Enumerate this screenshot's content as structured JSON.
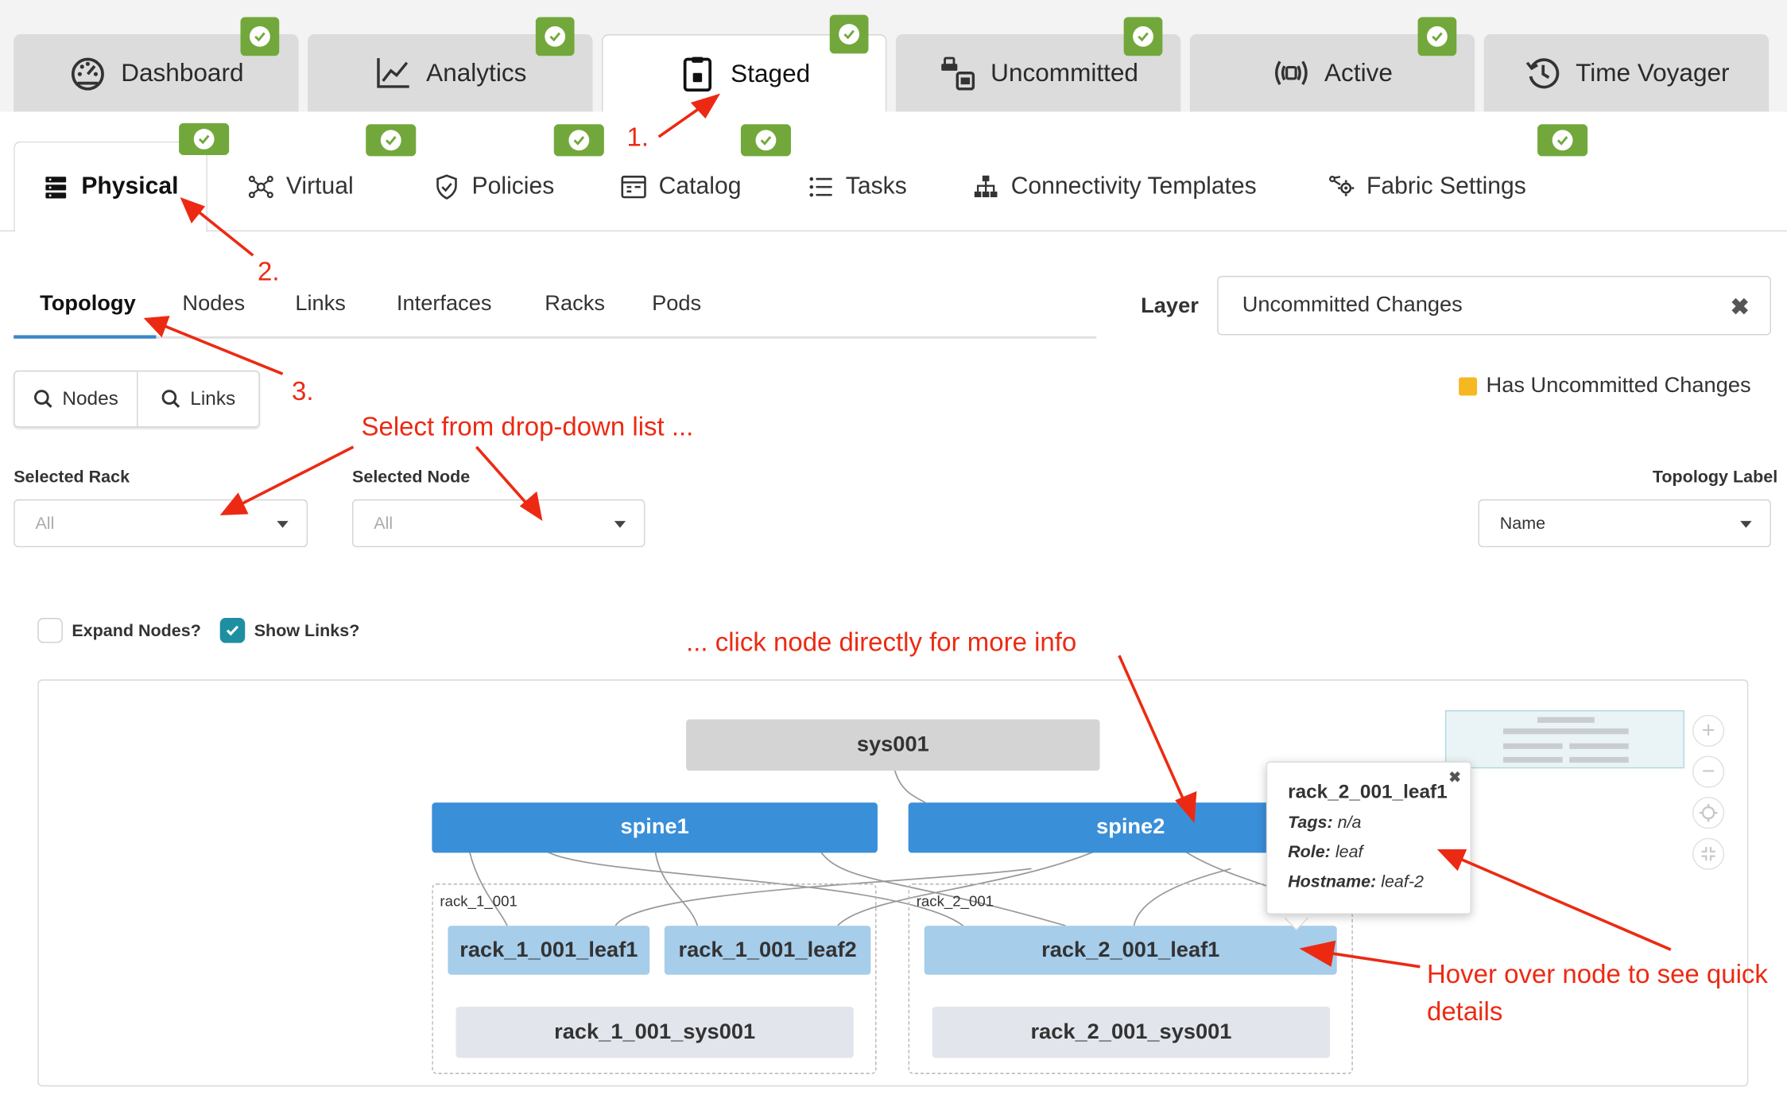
{
  "top_tabs": [
    {
      "label": "Dashboard",
      "icon": "dashboard-icon"
    },
    {
      "label": "Analytics",
      "icon": "analytics-icon"
    },
    {
      "label": "Staged",
      "icon": "staged-icon",
      "active": true
    },
    {
      "label": "Uncommitted",
      "icon": "uncommitted-icon"
    },
    {
      "label": "Active",
      "icon": "active-icon"
    },
    {
      "label": "Time Voyager",
      "icon": "time-voyager-icon"
    }
  ],
  "sub_tabs": [
    {
      "label": "Physical",
      "icon": "physical-icon",
      "active": true
    },
    {
      "label": "Virtual",
      "icon": "virtual-icon"
    },
    {
      "label": "Policies",
      "icon": "policies-icon"
    },
    {
      "label": "Catalog",
      "icon": "catalog-icon"
    },
    {
      "label": "Tasks",
      "icon": "tasks-icon"
    },
    {
      "label": "Connectivity Templates",
      "icon": "connectivity-templates-icon"
    },
    {
      "label": "Fabric Settings",
      "icon": "fabric-settings-icon"
    }
  ],
  "view_tabs": [
    {
      "label": "Topology",
      "active": true
    },
    {
      "label": "Nodes"
    },
    {
      "label": "Links"
    },
    {
      "label": "Interfaces"
    },
    {
      "label": "Racks"
    },
    {
      "label": "Pods"
    }
  ],
  "layer": {
    "label": "Layer",
    "value": "Uncommitted Changes",
    "clear": "✖"
  },
  "search_buttons": {
    "nodes": "Nodes",
    "links": "Links"
  },
  "legend": {
    "label": "Has Uncommitted Changes",
    "color": "#f6b821"
  },
  "filters": {
    "rack": {
      "label": "Selected Rack",
      "value": "All"
    },
    "node": {
      "label": "Selected Node",
      "value": "All"
    },
    "topology_label": {
      "label": "Topology Label",
      "value": "Name"
    }
  },
  "options": {
    "expand_nodes": {
      "label": "Expand Nodes?",
      "checked": false
    },
    "show_links": {
      "label": "Show Links?",
      "checked": true
    }
  },
  "topology": {
    "sys": "sys001",
    "spine1": "spine1",
    "spine2": "spine2",
    "rack1": "rack_1_001",
    "rack2": "rack_2_001",
    "rack1_leaf1": "rack_1_001_leaf1",
    "rack1_leaf2": "rack_1_001_leaf2",
    "rack2_leaf1": "rack_2_001_leaf1",
    "rack1_sys": "rack_1_001_sys001",
    "rack2_sys": "rack_2_001_sys001"
  },
  "tooltip": {
    "title": "rack_2_001_leaf1",
    "tags_label": "Tags:",
    "tags": "n/a",
    "role_label": "Role:",
    "role": "leaf",
    "hostname_label": "Hostname:",
    "hostname": "leaf-2",
    "close": "✖"
  },
  "zoom_controls": {
    "zoom_in": "+",
    "zoom_out": "−"
  },
  "annotations": {
    "step1": "1.",
    "step2": "2.",
    "step3": "3.",
    "dropdown": "Select from drop-down list ...",
    "click_node": "... click node directly for more info",
    "hover": "Hover over node to see quick details"
  },
  "colors": {
    "accent": "#3a87c8",
    "success": "#72a83b",
    "annotation": "#ec2a13",
    "spine": "#3a8fd9",
    "leaf": "#a6cdea"
  }
}
